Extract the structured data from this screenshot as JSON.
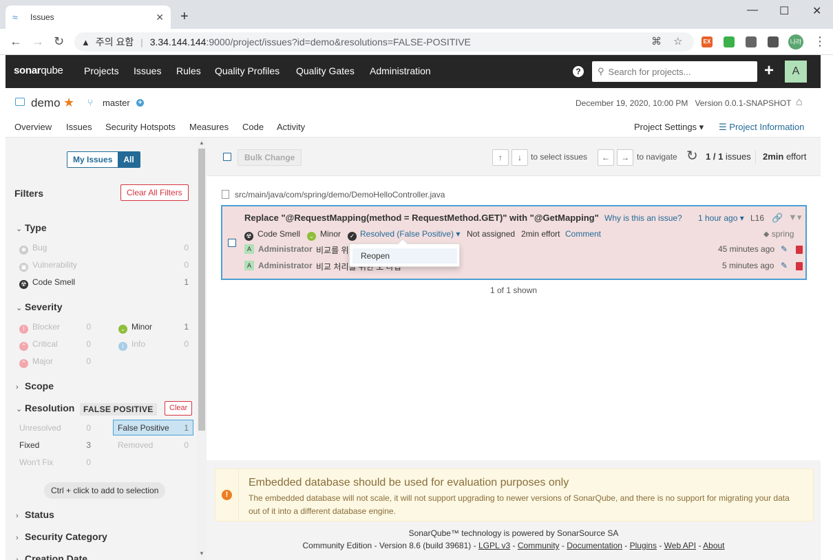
{
  "browser": {
    "tab_title": "Issues",
    "tab_close": "✕",
    "new_tab": "+",
    "win_minimize": "—",
    "win_maximize": "☐",
    "win_close": "✕",
    "security_warning": "주의 요함",
    "url_host": "3.34.144.144",
    "url_rest": ":9000/project/issues?id=demo&resolutions=FALSE-POSITIVE",
    "profile_label": "나라",
    "ext_ex": "EX"
  },
  "nav": {
    "logo_sonar": "sonar",
    "logo_qube": "qube",
    "items": [
      "Projects",
      "Issues",
      "Rules",
      "Quality Profiles",
      "Quality Gates",
      "Administration"
    ],
    "search_placeholder": "Search for projects...",
    "avatar": "A"
  },
  "project": {
    "name": "demo",
    "branch": "master",
    "date": "December 19, 2020, 10:00 PM",
    "version": "Version 0.0.1-SNAPSHOT",
    "tabs": [
      "Overview",
      "Issues",
      "Security Hotspots",
      "Measures",
      "Code",
      "Activity"
    ],
    "settings": "Project Settings ▾",
    "info": "Project Information"
  },
  "sidebar": {
    "my_issues": "My Issues",
    "all": "All",
    "filters": "Filters",
    "clear_all": "Clear All Filters",
    "type": {
      "title": "Type",
      "items": [
        {
          "label": "Bug",
          "count": "0"
        },
        {
          "label": "Vulnerability",
          "count": "0"
        },
        {
          "label": "Code Smell",
          "count": "1"
        }
      ]
    },
    "severity": {
      "title": "Severity",
      "items": [
        {
          "label": "Blocker",
          "count": "0"
        },
        {
          "label": "Minor",
          "count": "1"
        },
        {
          "label": "Critical",
          "count": "0"
        },
        {
          "label": "Info",
          "count": "0"
        },
        {
          "label": "Major",
          "count": "0"
        }
      ]
    },
    "scope": "Scope",
    "resolution": {
      "title": "Resolution",
      "badge": "FALSE POSITIVE",
      "clear": "Clear",
      "items": [
        {
          "label": "Unresolved",
          "count": "0"
        },
        {
          "label": "False Positive",
          "count": "1"
        },
        {
          "label": "Fixed",
          "count": "3"
        },
        {
          "label": "Removed",
          "count": "0"
        },
        {
          "label": "Won't Fix",
          "count": "0"
        }
      ]
    },
    "hint": "Ctrl + click to add to selection",
    "status": "Status",
    "security_category": "Security Category",
    "creation_date": "Creation Date"
  },
  "toolbar": {
    "bulk_change": "Bulk Change",
    "up": "↑",
    "down": "↓",
    "select_hint": "to select issues",
    "left": "←",
    "right": "→",
    "navigate_hint": "to navigate",
    "count": "1 / 1",
    "count_suffix": " issues",
    "effort_value": "2min",
    "effort_suffix": " effort"
  },
  "issue": {
    "file": "src/main/java/com/spring/demo/DemoHelloController.java",
    "title": "Replace \"@RequestMapping(method = RequestMethod.GET)\" with \"@GetMapping\"",
    "why": "Why is this an issue?",
    "ago": "1 hour ago ▾",
    "line": "L16",
    "type": "Code Smell",
    "severity": "Minor",
    "resolution": "Resolved (False Positive) ▾",
    "assignee": "Not assigned",
    "effort": "2min effort",
    "comment_link": "Comment",
    "tag": "spring",
    "comments": [
      {
        "avatar": "A",
        "author": "Administrator",
        "text": "비교를 위",
        "time": "45 minutes ago"
      },
      {
        "avatar": "A",
        "author": "Administrator",
        "text": "비교 처리를 위한 오 타입",
        "time": "5 minutes ago"
      }
    ],
    "popup_item": "Reopen",
    "shown": "1 of 1 shown"
  },
  "warning": {
    "title": "Embedded database should be used for evaluation purposes only",
    "body": "The embedded database will not scale, it will not support upgrading to newer versions of SonarQube, and there is no support for migrating your data out of it into a different database engine."
  },
  "footer": {
    "line1": "SonarQube™ technology is powered by SonarSource SA",
    "edition": "Community Edition - Version 8.6 (build 39681) -",
    "links": [
      "LGPL v3",
      "Community",
      "Documentation",
      "Plugins",
      "Web API",
      "About"
    ]
  }
}
